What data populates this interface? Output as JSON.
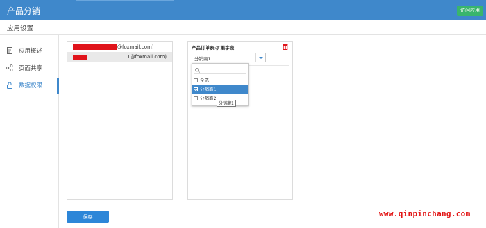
{
  "header": {
    "app_title": "产品分销",
    "visit_button": "访问应用",
    "accent": "#3f88cb"
  },
  "subheader": {
    "title": "应用设置"
  },
  "sidebar": {
    "items": [
      {
        "label": "应用概述",
        "icon": "document-icon"
      },
      {
        "label": "页面共享",
        "icon": "share-icon"
      },
      {
        "label": "数据权限",
        "icon": "lock-icon",
        "active": true
      }
    ]
  },
  "users": [
    {
      "email_suffix": "@foxmail.com)"
    },
    {
      "email_suffix": "1@foxmail.com)"
    }
  ],
  "field": {
    "title": "产品订单表-扩展字段",
    "selected_value": "分销商1",
    "options": [
      {
        "label": "全选",
        "checked": false
      },
      {
        "label": "分销商1",
        "checked": true
      },
      {
        "label": "分销商2",
        "checked": false
      }
    ],
    "tooltip": "分销商1"
  },
  "footer": {
    "save_label": "保存"
  },
  "watermark": "www.qinpinchang.com",
  "colors": {
    "save_button": "#2d86d8",
    "visit_button": "#39b56c",
    "redaction": "#e0141b",
    "watermark": "#e21414"
  }
}
